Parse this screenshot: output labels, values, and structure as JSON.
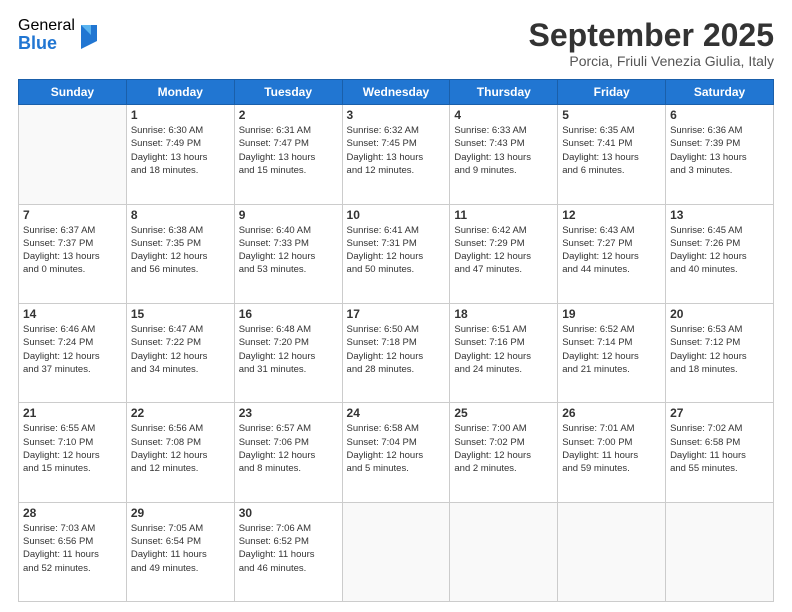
{
  "logo": {
    "general": "General",
    "blue": "Blue"
  },
  "header": {
    "month": "September 2025",
    "location": "Porcia, Friuli Venezia Giulia, Italy"
  },
  "weekdays": [
    "Sunday",
    "Monday",
    "Tuesday",
    "Wednesday",
    "Thursday",
    "Friday",
    "Saturday"
  ],
  "weeks": [
    [
      {
        "day": "",
        "info": ""
      },
      {
        "day": "1",
        "info": "Sunrise: 6:30 AM\nSunset: 7:49 PM\nDaylight: 13 hours\nand 18 minutes."
      },
      {
        "day": "2",
        "info": "Sunrise: 6:31 AM\nSunset: 7:47 PM\nDaylight: 13 hours\nand 15 minutes."
      },
      {
        "day": "3",
        "info": "Sunrise: 6:32 AM\nSunset: 7:45 PM\nDaylight: 13 hours\nand 12 minutes."
      },
      {
        "day": "4",
        "info": "Sunrise: 6:33 AM\nSunset: 7:43 PM\nDaylight: 13 hours\nand 9 minutes."
      },
      {
        "day": "5",
        "info": "Sunrise: 6:35 AM\nSunset: 7:41 PM\nDaylight: 13 hours\nand 6 minutes."
      },
      {
        "day": "6",
        "info": "Sunrise: 6:36 AM\nSunset: 7:39 PM\nDaylight: 13 hours\nand 3 minutes."
      }
    ],
    [
      {
        "day": "7",
        "info": "Sunrise: 6:37 AM\nSunset: 7:37 PM\nDaylight: 13 hours\nand 0 minutes."
      },
      {
        "day": "8",
        "info": "Sunrise: 6:38 AM\nSunset: 7:35 PM\nDaylight: 12 hours\nand 56 minutes."
      },
      {
        "day": "9",
        "info": "Sunrise: 6:40 AM\nSunset: 7:33 PM\nDaylight: 12 hours\nand 53 minutes."
      },
      {
        "day": "10",
        "info": "Sunrise: 6:41 AM\nSunset: 7:31 PM\nDaylight: 12 hours\nand 50 minutes."
      },
      {
        "day": "11",
        "info": "Sunrise: 6:42 AM\nSunset: 7:29 PM\nDaylight: 12 hours\nand 47 minutes."
      },
      {
        "day": "12",
        "info": "Sunrise: 6:43 AM\nSunset: 7:27 PM\nDaylight: 12 hours\nand 44 minutes."
      },
      {
        "day": "13",
        "info": "Sunrise: 6:45 AM\nSunset: 7:26 PM\nDaylight: 12 hours\nand 40 minutes."
      }
    ],
    [
      {
        "day": "14",
        "info": "Sunrise: 6:46 AM\nSunset: 7:24 PM\nDaylight: 12 hours\nand 37 minutes."
      },
      {
        "day": "15",
        "info": "Sunrise: 6:47 AM\nSunset: 7:22 PM\nDaylight: 12 hours\nand 34 minutes."
      },
      {
        "day": "16",
        "info": "Sunrise: 6:48 AM\nSunset: 7:20 PM\nDaylight: 12 hours\nand 31 minutes."
      },
      {
        "day": "17",
        "info": "Sunrise: 6:50 AM\nSunset: 7:18 PM\nDaylight: 12 hours\nand 28 minutes."
      },
      {
        "day": "18",
        "info": "Sunrise: 6:51 AM\nSunset: 7:16 PM\nDaylight: 12 hours\nand 24 minutes."
      },
      {
        "day": "19",
        "info": "Sunrise: 6:52 AM\nSunset: 7:14 PM\nDaylight: 12 hours\nand 21 minutes."
      },
      {
        "day": "20",
        "info": "Sunrise: 6:53 AM\nSunset: 7:12 PM\nDaylight: 12 hours\nand 18 minutes."
      }
    ],
    [
      {
        "day": "21",
        "info": "Sunrise: 6:55 AM\nSunset: 7:10 PM\nDaylight: 12 hours\nand 15 minutes."
      },
      {
        "day": "22",
        "info": "Sunrise: 6:56 AM\nSunset: 7:08 PM\nDaylight: 12 hours\nand 12 minutes."
      },
      {
        "day": "23",
        "info": "Sunrise: 6:57 AM\nSunset: 7:06 PM\nDaylight: 12 hours\nand 8 minutes."
      },
      {
        "day": "24",
        "info": "Sunrise: 6:58 AM\nSunset: 7:04 PM\nDaylight: 12 hours\nand 5 minutes."
      },
      {
        "day": "25",
        "info": "Sunrise: 7:00 AM\nSunset: 7:02 PM\nDaylight: 12 hours\nand 2 minutes."
      },
      {
        "day": "26",
        "info": "Sunrise: 7:01 AM\nSunset: 7:00 PM\nDaylight: 11 hours\nand 59 minutes."
      },
      {
        "day": "27",
        "info": "Sunrise: 7:02 AM\nSunset: 6:58 PM\nDaylight: 11 hours\nand 55 minutes."
      }
    ],
    [
      {
        "day": "28",
        "info": "Sunrise: 7:03 AM\nSunset: 6:56 PM\nDaylight: 11 hours\nand 52 minutes."
      },
      {
        "day": "29",
        "info": "Sunrise: 7:05 AM\nSunset: 6:54 PM\nDaylight: 11 hours\nand 49 minutes."
      },
      {
        "day": "30",
        "info": "Sunrise: 7:06 AM\nSunset: 6:52 PM\nDaylight: 11 hours\nand 46 minutes."
      },
      {
        "day": "",
        "info": ""
      },
      {
        "day": "",
        "info": ""
      },
      {
        "day": "",
        "info": ""
      },
      {
        "day": "",
        "info": ""
      }
    ]
  ]
}
